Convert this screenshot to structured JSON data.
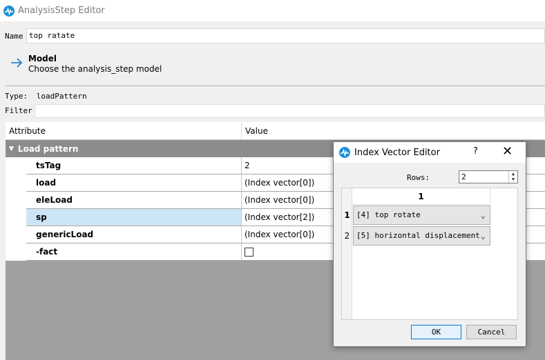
{
  "window": {
    "title": "AnalysisStep Editor",
    "icon": "pulse-icon"
  },
  "name_field": {
    "label": "Name",
    "value": "top ratate"
  },
  "model": {
    "icon": "arrow-right-icon",
    "heading": "Model",
    "subtitle": "Choose the analysis_step model"
  },
  "type": {
    "label": "Type:",
    "value": "loadPattern"
  },
  "filter": {
    "label": "Filter",
    "value": ""
  },
  "table": {
    "headers": {
      "attribute": "Attribute",
      "value": "Value"
    },
    "group": "Load pattern",
    "rows": [
      {
        "attribute": "tsTag",
        "value": "2"
      },
      {
        "attribute": "load",
        "value": "(Index vector[0])"
      },
      {
        "attribute": "eleLoad",
        "value": "(Index vector[0])"
      },
      {
        "attribute": "sp",
        "value": "(Index vector[2])"
      },
      {
        "attribute": "genericLoad",
        "value": "(Index vector[0])"
      },
      {
        "attribute": "-fact",
        "value": ""
      }
    ],
    "selected_row": "sp"
  },
  "dialog": {
    "title": "Index Vector Editor",
    "help": "?",
    "close": "✕",
    "rows_label": "Rows:",
    "rows_value": "2",
    "column_header": "1",
    "row_numbers": [
      "1",
      "2"
    ],
    "items": [
      "[4] top rotate",
      "[5] horizontal displacement"
    ],
    "ok_label": "OK",
    "cancel_label": "Cancel"
  }
}
